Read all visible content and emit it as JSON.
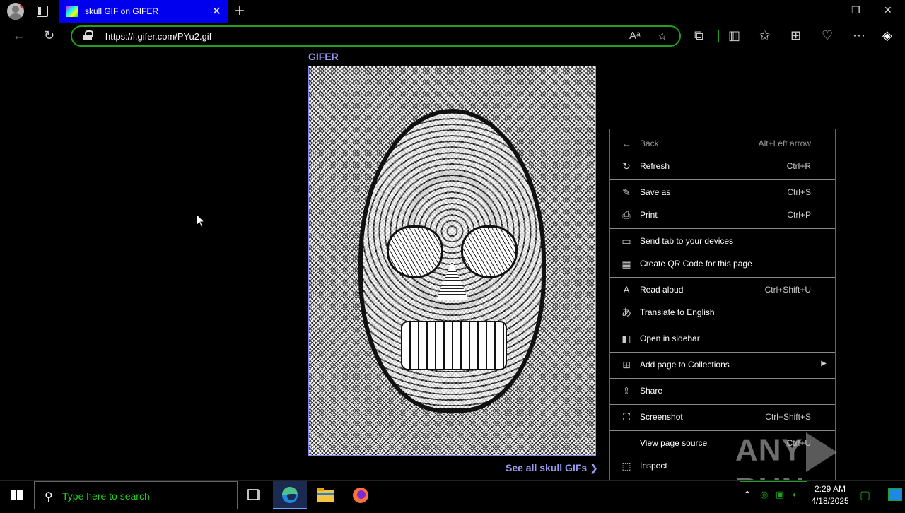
{
  "browser": {
    "tab": {
      "title": "skull GIF on GIFER"
    },
    "address": {
      "url": "https://i.gifer.com/PYu2.gif"
    }
  },
  "page": {
    "brand": "GIFER",
    "see_all": "See all skull GIFs"
  },
  "context_menu": {
    "items": [
      {
        "label": "Back",
        "shortcut": "Alt+Left arrow",
        "icon": "back-arrow-icon",
        "disabled": true
      },
      {
        "label": "Refresh",
        "shortcut": "Ctrl+R",
        "icon": "refresh-icon"
      },
      {
        "label": "Save as",
        "shortcut": "Ctrl+S",
        "icon": "save-as-icon"
      },
      {
        "label": "Print",
        "shortcut": "Ctrl+P",
        "icon": "printer-icon"
      },
      {
        "label": "Send tab to your devices",
        "shortcut": "",
        "icon": "send-to-devices-icon"
      },
      {
        "label": "Create QR Code for this page",
        "shortcut": "",
        "icon": "qr-code-icon"
      },
      {
        "label": "Read aloud",
        "shortcut": "Ctrl+Shift+U",
        "icon": "read-aloud-icon"
      },
      {
        "label": "Translate to English",
        "shortcut": "",
        "icon": "translate-icon"
      },
      {
        "label": "Open in sidebar",
        "shortcut": "",
        "icon": "open-in-sidebar-icon"
      },
      {
        "label": "Add page to Collections",
        "shortcut": "",
        "icon": "collections-icon"
      },
      {
        "label": "Share",
        "shortcut": "",
        "icon": "share-icon"
      },
      {
        "label": "Screenshot",
        "shortcut": "Ctrl+Shift+S",
        "icon": "screenshot-icon"
      },
      {
        "label": "View page source",
        "shortcut": "Ctrl+U",
        "icon": ""
      },
      {
        "label": "Inspect",
        "shortcut": "",
        "icon": "inspect-icon"
      }
    ]
  },
  "taskbar": {
    "search_placeholder": "Type here to search",
    "time": "2:29 AM",
    "date": "4/18/2025"
  },
  "watermark": {
    "left": "ANY",
    "right": "RUN"
  },
  "colors": {
    "accent": "#9a9af0",
    "tab_active": "#0000ee",
    "address_border": "#1fa01f",
    "search_text": "#1fd21f"
  }
}
